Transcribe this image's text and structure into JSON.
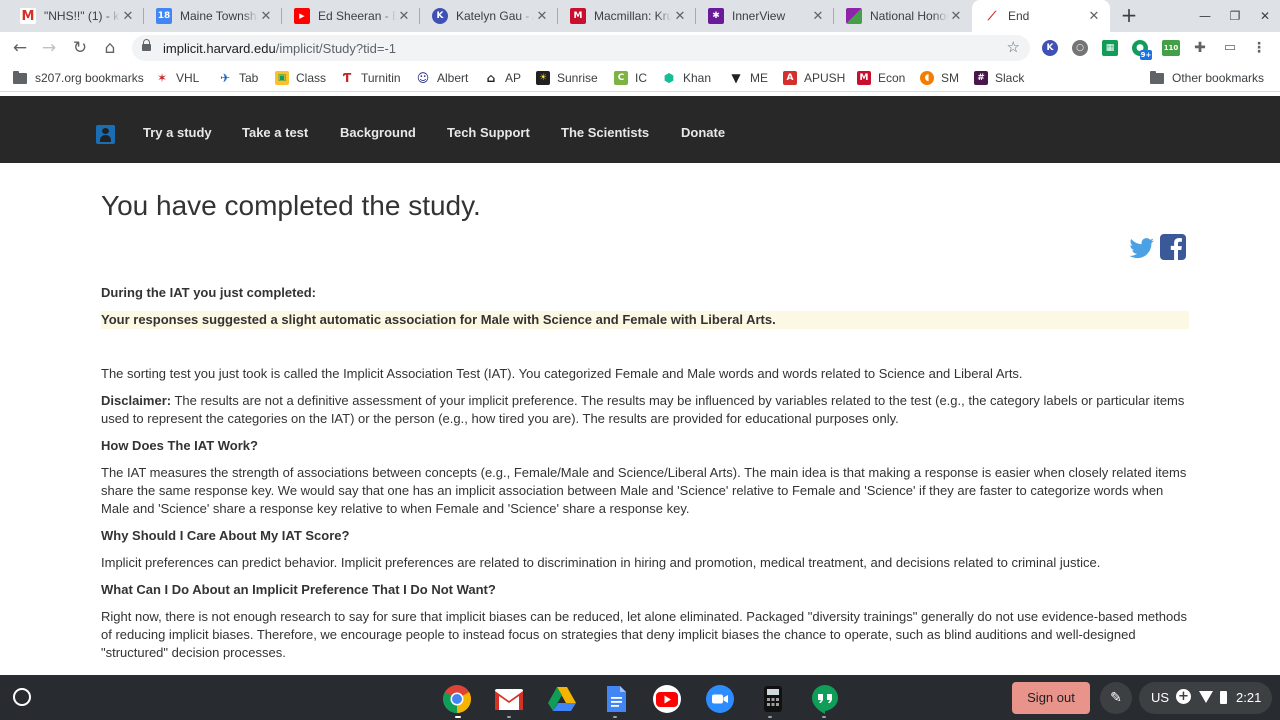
{
  "browser": {
    "tabs": [
      {
        "title": "\"NHS!!\" (1) - kgau",
        "icon": "gmail-icon",
        "color": "#d93025",
        "glyph": "M"
      },
      {
        "title": "Maine Township",
        "icon": "calendar-icon",
        "color": "#4285f4",
        "glyph": "18"
      },
      {
        "title": "Ed Sheeran - Bes",
        "icon": "youtube-icon",
        "color": "#ff0000",
        "glyph": "▶"
      },
      {
        "title": "Katelyn Gau - Al",
        "icon": "k-icon",
        "color": "#3f51b5",
        "glyph": "K"
      },
      {
        "title": "Macmillan: Krug",
        "icon": "macmillan-icon",
        "color": "#c8102e",
        "glyph": "M"
      },
      {
        "title": "InnerView",
        "icon": "innerview-icon",
        "color": "#6a1b9a",
        "glyph": "✱"
      },
      {
        "title": "National Honor",
        "icon": "nhs-icon",
        "color": "#8e24aa",
        "glyph": "N"
      },
      {
        "title": "End",
        "icon": "project-implicit-icon",
        "color": "#d32f2f",
        "glyph": "⟋"
      }
    ],
    "url_host": "implicit.harvard.edu",
    "url_path": "/implicit/Study?tid=-1",
    "bookmarks": [
      {
        "label": "s207.org bookmarks",
        "icon": "folder-icon"
      },
      {
        "label": "VHL",
        "icon": "vhl-icon",
        "color": "#c62828",
        "glyph": "✶"
      },
      {
        "label": "Tab",
        "icon": "tab-icon",
        "color": "#1565c0",
        "glyph": "✈"
      },
      {
        "label": "Class",
        "icon": "classroom-icon",
        "color": "#0f9d58",
        "glyph": "▣"
      },
      {
        "label": "Turnitin",
        "icon": "turnitin-icon",
        "color": "#c62828",
        "glyph": "Ƭ"
      },
      {
        "label": "Albert",
        "icon": "albert-icon",
        "color": "#1a237e",
        "glyph": "☺"
      },
      {
        "label": "AP",
        "icon": "ap-icon",
        "color": "#202124",
        "glyph": "⌂"
      },
      {
        "label": "Sunrise",
        "icon": "sunrise-icon",
        "color": "#212121",
        "glyph": "☀"
      },
      {
        "label": "IC",
        "icon": "ic-icon",
        "color": "#7cb342",
        "glyph": "C"
      },
      {
        "label": "Khan",
        "icon": "khan-icon",
        "color": "#14bf96",
        "glyph": "⬢"
      },
      {
        "label": "ME",
        "icon": "me-icon",
        "color": "#212121",
        "glyph": "▼"
      },
      {
        "label": "APUSH",
        "icon": "apush-icon",
        "color": "#d32f2f",
        "glyph": "A"
      },
      {
        "label": "Econ",
        "icon": "econ-icon",
        "color": "#c8102e",
        "glyph": "M"
      },
      {
        "label": "SM",
        "icon": "sm-icon",
        "color": "#f57c00",
        "glyph": "◖"
      },
      {
        "label": "Slack",
        "icon": "slack-icon",
        "color": "#4a154b",
        "glyph": "#"
      }
    ],
    "other_bookmarks": "Other bookmarks"
  },
  "site": {
    "nav": [
      "Try a study",
      "Take a test",
      "Background",
      "Tech Support",
      "The Scientists",
      "Donate"
    ]
  },
  "page": {
    "title": "You have completed the study.",
    "during_label": "During the IAT you just completed:",
    "result": "Your responses suggested a slight automatic association for Male with Science and Female with Liberal Arts.",
    "intro": "The sorting test you just took is called the Implicit Association Test (IAT). You categorized Female and Male words and words related to Science and Liberal Arts.",
    "disclaimer_label": "Disclaimer:",
    "disclaimer_text": " The results are not a definitive assessment of your implicit preference. The results may be influenced by variables related to the test (e.g., the category labels or particular items used to represent the categories on the IAT) or the person (e.g., how tired you are). The results are provided for educational purposes only.",
    "h_how": "How Does The IAT Work?",
    "p_how": "The IAT measures the strength of associations between concepts (e.g., Female/Male and Science/Liberal Arts). The main idea is that making a response is easier when closely related items share the same response key. We would say that one has an implicit association between Male and 'Science' relative to Female and 'Science' if they are faster to categorize words when Male and 'Science' share a response key relative to when Female and 'Science' share a response key.",
    "h_why": "Why Should I Care About My IAT Score?",
    "p_why": "Implicit preferences can predict behavior. Implicit preferences are related to discrimination in hiring and promotion, medical treatment, and decisions related to criminal justice.",
    "h_what": "What Can I Do About an Implicit Preference That I Do Not Want?",
    "p_what": "Right now, there is not enough research to say for sure that implicit biases can be reduced, let alone eliminated. Packaged \"diversity trainings\" generally do not use evidence-based methods of reducing implicit biases. Therefore, we encourage people to instead focus on strategies that deny implicit biases the chance to operate, such as blind auditions and well-designed \"structured\" decision processes."
  },
  "shelf": {
    "sign_out": "Sign out",
    "locale": "US",
    "time": "2:21",
    "extension_badge": "9+",
    "extension_count": "110"
  }
}
